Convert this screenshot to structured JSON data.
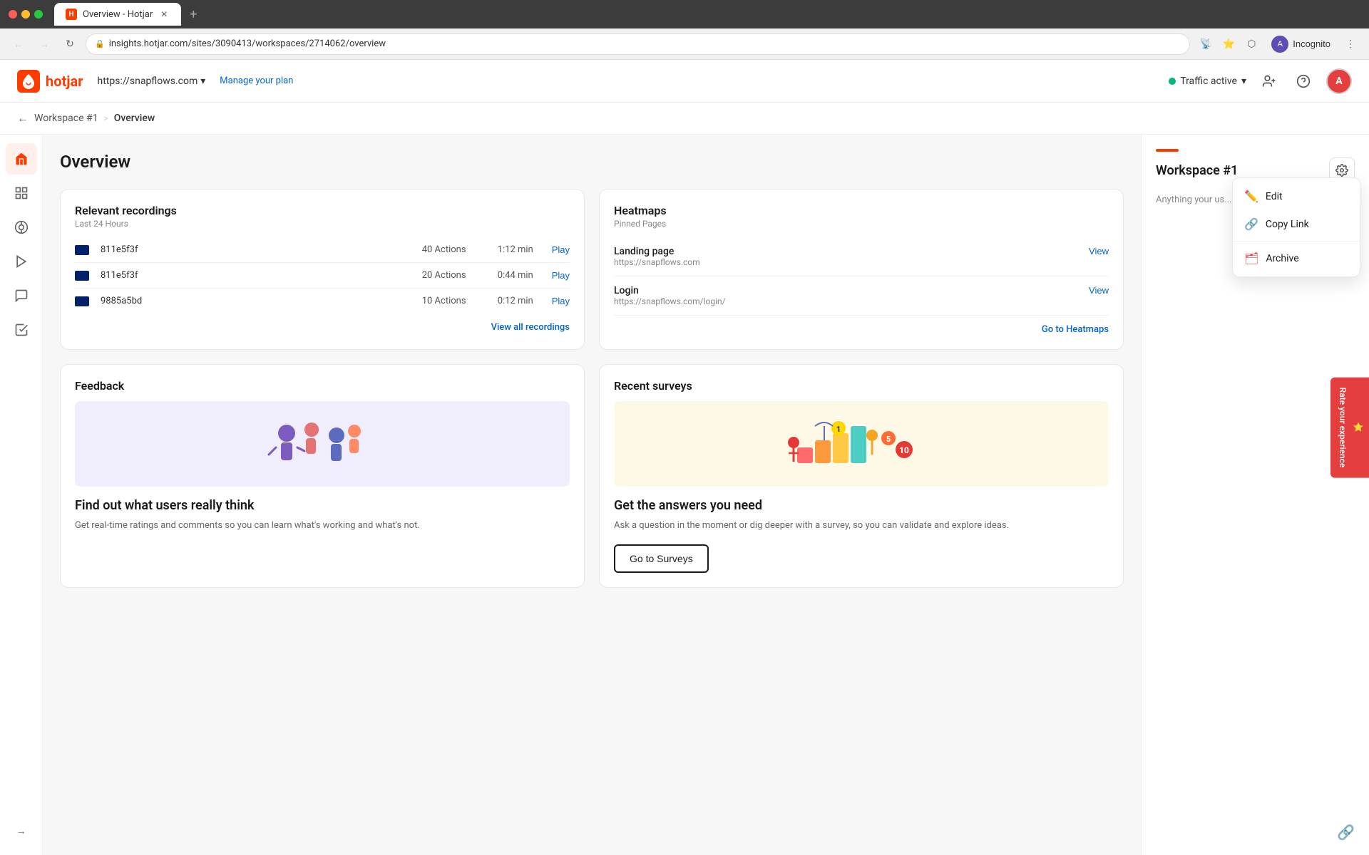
{
  "browser": {
    "tab_title": "Overview - Hotjar",
    "tab_icon": "H",
    "address_url": "insights.hotjar.com/sites/3090413/workspaces/2714062/overview",
    "address_display": "insights.hotjar.com/sites/3090413/workspaces/2714062/overview",
    "new_tab_label": "+",
    "incognito_label": "Incognito"
  },
  "header": {
    "logo_text": "hotjar",
    "site_url": "https://snapflows.com",
    "manage_plan_label": "Manage your plan",
    "traffic_active_label": "Traffic active",
    "chevron": "▾",
    "add_user_icon": "person-plus",
    "help_icon": "?",
    "user_initial": "A"
  },
  "breadcrumb": {
    "back_label": "←",
    "workspace_label": "Workspace #1",
    "separator": ">",
    "current_label": "Overview"
  },
  "sidebar": {
    "items": [
      {
        "icon": "⌂",
        "label": "Home",
        "active": true
      },
      {
        "icon": "⊞",
        "label": "Dashboard",
        "active": false
      },
      {
        "icon": "◎",
        "label": "Heatmaps",
        "active": false
      },
      {
        "icon": "▶",
        "label": "Recordings",
        "active": false
      },
      {
        "icon": "☺",
        "label": "Feedback",
        "active": false
      },
      {
        "icon": "📋",
        "label": "Surveys",
        "active": false
      }
    ],
    "expand_icon": "→"
  },
  "page": {
    "title": "Overview"
  },
  "recordings_card": {
    "title": "Relevant recordings",
    "subtitle": "Last 24 Hours",
    "rows": [
      {
        "id": "811e5f3f",
        "actions": "40 Actions",
        "time": "1:12 min",
        "play_label": "Play"
      },
      {
        "id": "811e5f3f",
        "actions": "20 Actions",
        "time": "0:44 min",
        "play_label": "Play"
      },
      {
        "id": "9885a5bd",
        "actions": "10 Actions",
        "time": "0:12 min",
        "play_label": "Play"
      }
    ],
    "view_all_label": "View all recordings"
  },
  "heatmaps_card": {
    "title": "Heatmaps",
    "subtitle": "Pinned Pages",
    "items": [
      {
        "name": "Landing page",
        "url": "https://snapflows.com",
        "view_label": "View"
      },
      {
        "name": "Login",
        "url": "https://snapflows.com/login/",
        "view_label": "View"
      }
    ],
    "go_to_label": "Go to Heatmaps"
  },
  "feedback_card": {
    "title": "Feedback",
    "heading": "Find out what users really think",
    "description": "Get real-time ratings and comments so you can learn what's working and what's not."
  },
  "surveys_card": {
    "title": "Recent surveys",
    "heading": "Get the answers you need",
    "description": "Ask a question in the moment or dig deeper with a survey, so you can validate and explore ideas.",
    "go_to_label": "Go to Surveys"
  },
  "workspace_panel": {
    "title": "Workspace #1",
    "description": "Anything your us...",
    "settings_icon": "⚙",
    "red_bar": true
  },
  "dropdown_menu": {
    "items": [
      {
        "label": "Edit",
        "icon": "✏️",
        "type": "edit"
      },
      {
        "label": "Copy Link",
        "icon": "🔗",
        "type": "copy"
      },
      {
        "label": "Archive",
        "icon": "🗂",
        "type": "archive"
      }
    ]
  },
  "rate_experience": {
    "label": "Rate your experience",
    "icon": "★"
  }
}
